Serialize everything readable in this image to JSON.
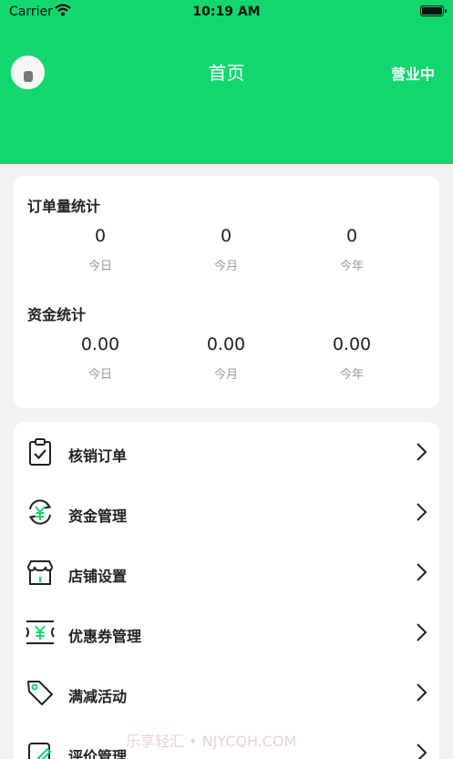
{
  "status_bar": {
    "carrier": "Carrier",
    "time": "10:19 AM"
  },
  "header": {
    "title": "首页",
    "status": "营业中",
    "background_color": "#12d76f",
    "avatar_icon": "user-avatar"
  },
  "order_stats": {
    "title": "订单量统计",
    "items": [
      {
        "value": "0",
        "label": "今日"
      },
      {
        "value": "0",
        "label": "今月"
      },
      {
        "value": "0",
        "label": "今年"
      }
    ]
  },
  "fund_stats": {
    "title": "资金统计",
    "items": [
      {
        "value": "0.00",
        "label": "今日"
      },
      {
        "value": "0.00",
        "label": "今月"
      },
      {
        "value": "0.00",
        "label": "今年"
      }
    ]
  },
  "menu": [
    {
      "label": "核销订单",
      "icon": "clipboard-check-icon"
    },
    {
      "label": "资金管理",
      "icon": "yuan-refresh-icon"
    },
    {
      "label": "店铺设置",
      "icon": "shop-icon"
    },
    {
      "label": "优惠券管理",
      "icon": "coupon-icon"
    },
    {
      "label": "满减活动",
      "icon": "price-tag-icon"
    },
    {
      "label": "评价管理",
      "icon": "edit-review-icon"
    }
  ],
  "watermark": "乐享轻汇 • NJYCQH.COM"
}
